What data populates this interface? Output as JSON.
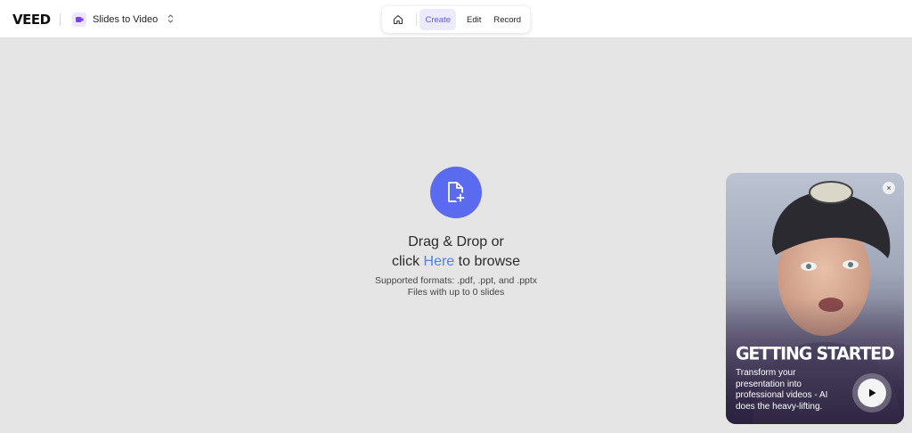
{
  "app": {
    "logo": "VEED"
  },
  "project": {
    "name": "Slides to Video"
  },
  "nav": {
    "tabs": [
      {
        "label": "Create"
      },
      {
        "label": "Edit"
      },
      {
        "label": "Record"
      }
    ]
  },
  "upload": {
    "line1": "Drag & Drop or",
    "line2_prefix": "click",
    "line2_link": "Here",
    "line2_suffix": "to browse",
    "formats": "Supported formats: .pdf, .ppt, and .pptx",
    "limit": "Files with up to 0 slides"
  },
  "promo": {
    "title": "GETTING STARTED",
    "description": "Transform your presentation into professional videos - AI does the heavy-lifting.",
    "close": "×"
  },
  "colors": {
    "accent": "#5b6bf0",
    "active_tab_bg": "#eceaff",
    "link": "#4a82f0"
  }
}
